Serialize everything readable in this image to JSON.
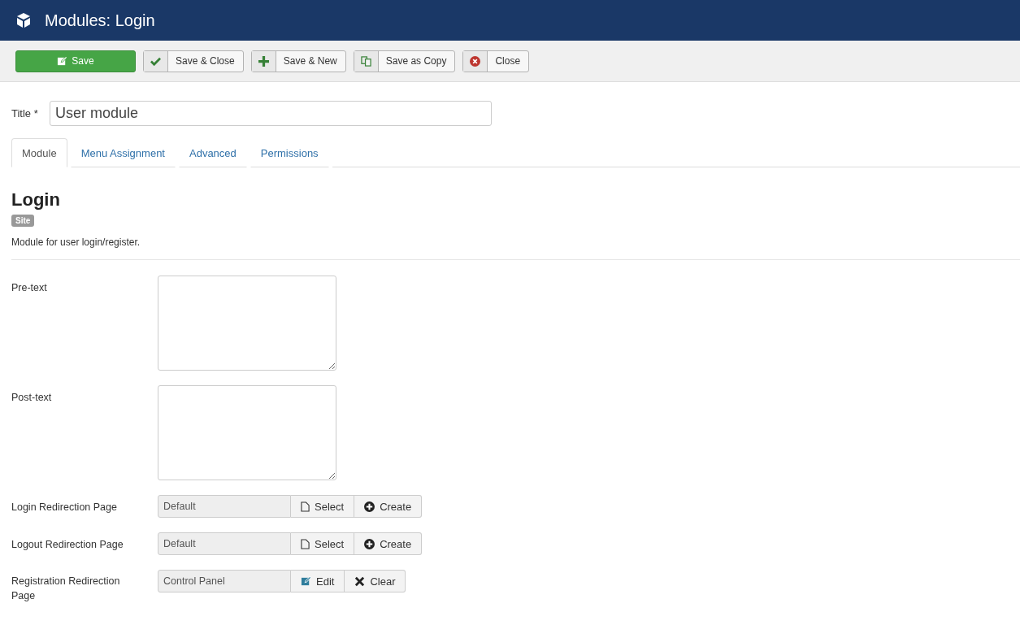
{
  "header": {
    "title": "Modules: Login"
  },
  "toolbar": [
    {
      "label": "Save",
      "kind": "edit",
      "primary": true
    },
    {
      "label": "Save & Close",
      "kind": "check",
      "primary": false
    },
    {
      "label": "Save & New",
      "kind": "plus",
      "primary": false
    },
    {
      "label": "Save as Copy",
      "kind": "copy",
      "primary": false
    },
    {
      "label": "Close",
      "kind": "cancel",
      "primary": false
    }
  ],
  "title_field": {
    "label": "Title *",
    "value": "User module"
  },
  "tabs": [
    {
      "label": "Module",
      "selected": true
    },
    {
      "label": "Menu Assignment",
      "selected": false
    },
    {
      "label": "Advanced",
      "selected": false
    },
    {
      "label": "Permissions",
      "selected": false
    }
  ],
  "module": {
    "heading": "Login",
    "badge": "Site",
    "description": "Module for user login/register."
  },
  "fields": [
    {
      "kind": "textarea",
      "label": "Pre-text"
    },
    {
      "kind": "textarea",
      "label": "Post-text"
    },
    {
      "kind": "modal",
      "label": "Login Redirection Page",
      "value": "Default",
      "buttons": [
        {
          "label": "Select",
          "kind": "file"
        },
        {
          "label": "Create",
          "kind": "plus-circle"
        }
      ]
    },
    {
      "kind": "modal",
      "label": "Logout Redirection Page",
      "value": "Default",
      "buttons": [
        {
          "label": "Select",
          "kind": "file"
        },
        {
          "label": "Create",
          "kind": "plus-circle"
        }
      ]
    },
    {
      "kind": "modal",
      "label": "Registration Redirection Page",
      "value": "Control Panel",
      "buttons": [
        {
          "label": "Edit",
          "kind": "edit"
        },
        {
          "label": "Clear",
          "kind": "times"
        }
      ]
    }
  ]
}
